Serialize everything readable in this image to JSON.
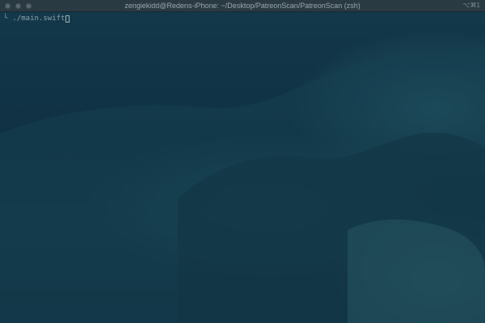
{
  "window": {
    "title": "zengiekidd@Redens-iPhone: ~/Desktop/PatreonScan/PatreonScan (zsh)",
    "shortcut": "⌥⌘1"
  },
  "terminal": {
    "prompt_glyph": "└",
    "command": "./main.swift"
  },
  "colors": {
    "background": "#143445",
    "text": "#8fa2ab",
    "titlebar": "#2a3a42"
  },
  "icons": [
    "close-light",
    "minimize-light",
    "zoom-light",
    "cursor-block"
  ]
}
